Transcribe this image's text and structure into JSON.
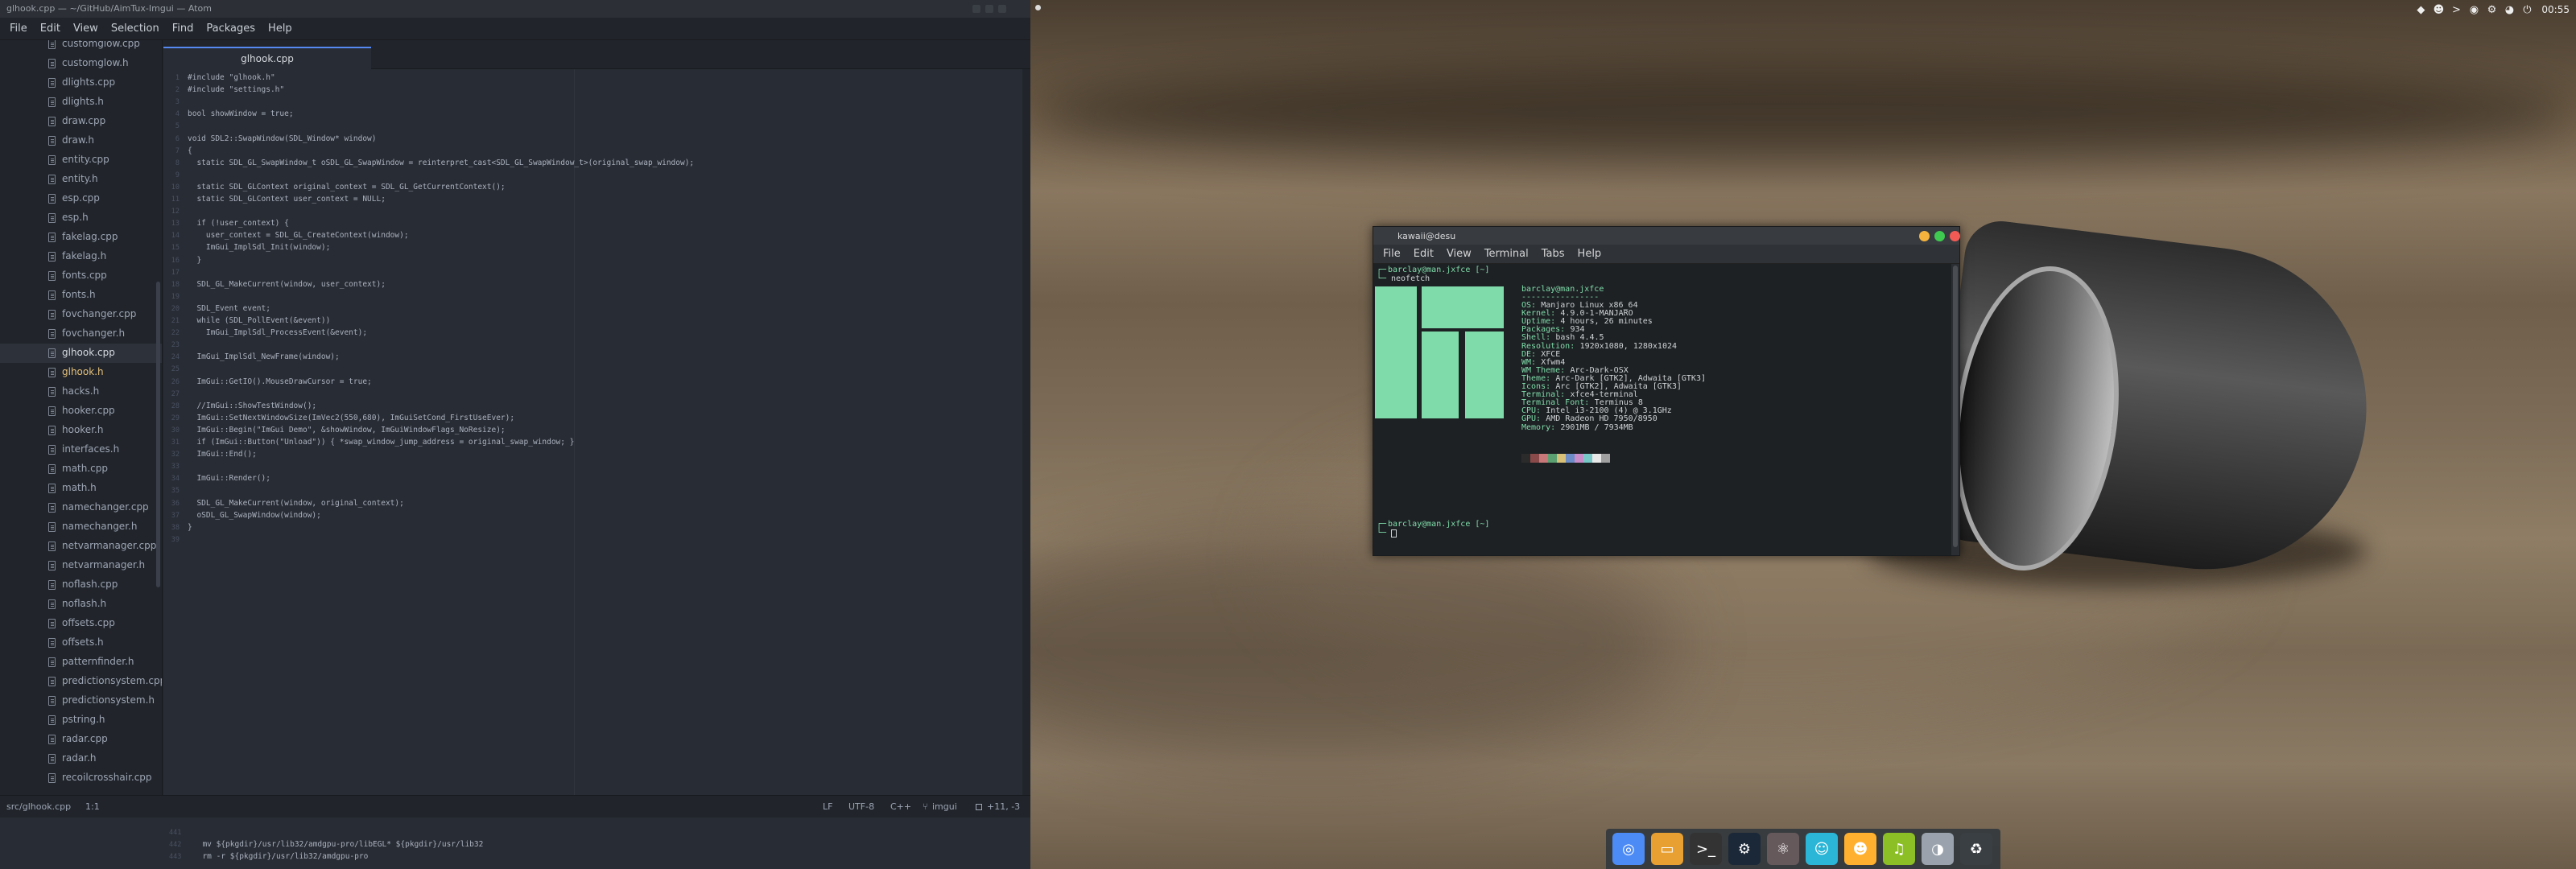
{
  "editor": {
    "window_title": "glhook.cpp — ~/GitHub/AimTux-Imgui — Atom",
    "menu": [
      "File",
      "Edit",
      "View",
      "Selection",
      "Find",
      "Packages",
      "Help"
    ],
    "tree_items": [
      {
        "label": "customgiow.cpp",
        "state": "normal"
      },
      {
        "label": "customglow.h",
        "state": "normal"
      },
      {
        "label": "dlights.cpp",
        "state": "normal"
      },
      {
        "label": "dlights.h",
        "state": "normal"
      },
      {
        "label": "draw.cpp",
        "state": "normal"
      },
      {
        "label": "draw.h",
        "state": "normal"
      },
      {
        "label": "entity.cpp",
        "state": "normal"
      },
      {
        "label": "entity.h",
        "state": "normal"
      },
      {
        "label": "esp.cpp",
        "state": "normal"
      },
      {
        "label": "esp.h",
        "state": "normal"
      },
      {
        "label": "fakelag.cpp",
        "state": "normal"
      },
      {
        "label": "fakelag.h",
        "state": "normal"
      },
      {
        "label": "fonts.cpp",
        "state": "normal"
      },
      {
        "label": "fonts.h",
        "state": "normal"
      },
      {
        "label": "fovchanger.cpp",
        "state": "normal"
      },
      {
        "label": "fovchanger.h",
        "state": "normal"
      },
      {
        "label": "glhook.cpp",
        "state": "active"
      },
      {
        "label": "glhook.h",
        "state": "hl"
      },
      {
        "label": "hacks.h",
        "state": "normal"
      },
      {
        "label": "hooker.cpp",
        "state": "normal"
      },
      {
        "label": "hooker.h",
        "state": "normal"
      },
      {
        "label": "interfaces.h",
        "state": "normal"
      },
      {
        "label": "math.cpp",
        "state": "normal"
      },
      {
        "label": "math.h",
        "state": "normal"
      },
      {
        "label": "namechanger.cpp",
        "state": "normal"
      },
      {
        "label": "namechanger.h",
        "state": "normal"
      },
      {
        "label": "netvarmanager.cpp",
        "state": "normal"
      },
      {
        "label": "netvarmanager.h",
        "state": "normal"
      },
      {
        "label": "noflash.cpp",
        "state": "normal"
      },
      {
        "label": "noflash.h",
        "state": "normal"
      },
      {
        "label": "offsets.cpp",
        "state": "normal"
      },
      {
        "label": "offsets.h",
        "state": "normal"
      },
      {
        "label": "patternfinder.h",
        "state": "normal"
      },
      {
        "label": "predictionsystem.cpp",
        "state": "normal"
      },
      {
        "label": "predictionsystem.h",
        "state": "normal"
      },
      {
        "label": "pstring.h",
        "state": "normal"
      },
      {
        "label": "radar.cpp",
        "state": "normal"
      },
      {
        "label": "radar.h",
        "state": "normal"
      },
      {
        "label": "recoilcrosshair.cpp",
        "state": "normal"
      }
    ],
    "active_tab": "glhook.cpp",
    "code_lines": [
      "#include \"glhook.h\"",
      "#include \"settings.h\"",
      "",
      "bool showWindow = true;",
      "",
      "void SDL2::SwapWindow(SDL_Window* window)",
      "{",
      "  static SDL_GL_SwapWindow_t oSDL_GL_SwapWindow = reinterpret_cast<SDL_GL_SwapWindow_t>(original_swap_window);",
      "",
      "  static SDL_GLContext original_context = SDL_GL_GetCurrentContext();",
      "  static SDL_GLContext user_context = NULL;",
      "",
      "  if (!user_context) {",
      "    user_context = SDL_GL_CreateContext(window);",
      "    ImGui_ImplSdl_Init(window);",
      "  }",
      "",
      "  SDL_GL_MakeCurrent(window, user_context);",
      "",
      "  SDL_Event event;",
      "  while (SDL_PollEvent(&event))",
      "    ImGui_ImplSdl_ProcessEvent(&event);",
      "",
      "  ImGui_ImplSdl_NewFrame(window);",
      "",
      "  ImGui::GetIO().MouseDrawCursor = true;",
      "",
      "  //ImGui::ShowTestWindow();",
      "  ImGui::SetNextWindowSize(ImVec2(550,680), ImGuiSetCond_FirstUseEver);",
      "  ImGui::Begin(\"ImGui Demo\", &showWindow, ImGuiWindowFlags_NoResize);",
      "  if (ImGui::Button(\"Unload\")) { *swap_window_jump_address = original_swap_window; }",
      "  ImGui::End();",
      "",
      "  ImGui::Render();",
      "",
      "  SDL_GL_MakeCurrent(window, original_context);",
      "  oSDL_GL_SwapWindow(window);",
      "}",
      ""
    ],
    "status": {
      "path": "src/glhook.cpp",
      "cursor": "1:1",
      "line_ending": "LF",
      "encoding": "UTF-8",
      "grammar": "C++",
      "branch": "imgui",
      "diff": "+11, -3"
    },
    "bottom_lines": [
      {
        "n": "441",
        "text": ""
      },
      {
        "n": "442",
        "text": "  mv ${pkgdir}/usr/lib32/amdgpu-pro/libEGL* ${pkgdir}/usr/lib32"
      },
      {
        "n": "443",
        "text": "  rm -r ${pkgdir}/usr/lib32/amdgpu-pro"
      }
    ]
  },
  "desktop": {
    "clock": "00:55",
    "tray_icons": [
      "dropbox-icon",
      "discord-icon",
      "terminal-icon",
      "steam-icon",
      "settings-icon",
      "steam-icon",
      "power-icon"
    ],
    "terminal": {
      "title": "kawaii@desu",
      "menu": [
        "File",
        "Edit",
        "View",
        "Terminal",
        "Tabs",
        "Help"
      ],
      "prompt1": "barclay@man.jxfce [~]",
      "command1": "neofetch",
      "user_host": "barclay@man.jxfce",
      "separator": "----------------",
      "info": [
        {
          "key": "OS:",
          "value": "Manjaro Linux x86_64"
        },
        {
          "key": "Kernel:",
          "value": "4.9.0-1-MANJARO"
        },
        {
          "key": "Uptime:",
          "value": "4 hours, 26 minutes"
        },
        {
          "key": "Packages:",
          "value": "934"
        },
        {
          "key": "Shell:",
          "value": "bash 4.4.5"
        },
        {
          "key": "Resolution:",
          "value": "1920x1080, 1280x1024"
        },
        {
          "key": "DE:",
          "value": "XFCE"
        },
        {
          "key": "WM:",
          "value": "Xfwm4"
        },
        {
          "key": "WM Theme:",
          "value": "Arc-Dark-OSX"
        },
        {
          "key": "Theme:",
          "value": "Arc-Dark [GTK2], Adwaita [GTK3]"
        },
        {
          "key": "Icons:",
          "value": "Arc [GTK2], Adwaita [GTK3]"
        },
        {
          "key": "Terminal:",
          "value": "xfce4-terminal"
        },
        {
          "key": "Terminal Font:",
          "value": "Terminus 8"
        },
        {
          "key": "CPU:",
          "value": "Intel i3-2100 (4) @ 3.1GHz"
        },
        {
          "key": "GPU:",
          "value": "AMD Radeon HD 7950/8950"
        },
        {
          "key": "Memory:",
          "value": "2901MB / 7934MB"
        }
      ],
      "palette": [
        "#2b2b2b",
        "#8a4a4a",
        "#c87878",
        "#5aa070",
        "#d8c078",
        "#6c8cc8",
        "#c88cc8",
        "#78c8c8",
        "#e8e8e8",
        "#a0a0a0"
      ],
      "prompt2": "barclay@man.jxfce [~]",
      "logo_color": "#7fdcaa"
    },
    "dock_apps": [
      {
        "name": "chromium-app",
        "glyph": "◎",
        "color": "#4c8bf5"
      },
      {
        "name": "files-app",
        "glyph": "▭",
        "color": "#e8a033"
      },
      {
        "name": "terminal-app",
        "glyph": ">_",
        "color": "#333333"
      },
      {
        "name": "steam-app",
        "glyph": "⚙",
        "color": "#1b2838"
      },
      {
        "name": "atom-app",
        "glyph": "⚛",
        "color": "#66595c"
      },
      {
        "name": "store-app",
        "glyph": "☺",
        "color": "#2bb5d6"
      },
      {
        "name": "discord-app",
        "glyph": "☻",
        "color": "#ffb02e"
      },
      {
        "name": "spotify-app",
        "glyph": "♫",
        "color": "#8cbf26"
      },
      {
        "name": "steam2-app",
        "glyph": "◑",
        "color": "#9aa3ad"
      },
      {
        "name": "trash-app",
        "glyph": "♻",
        "color": "#3a3f44"
      }
    ]
  }
}
